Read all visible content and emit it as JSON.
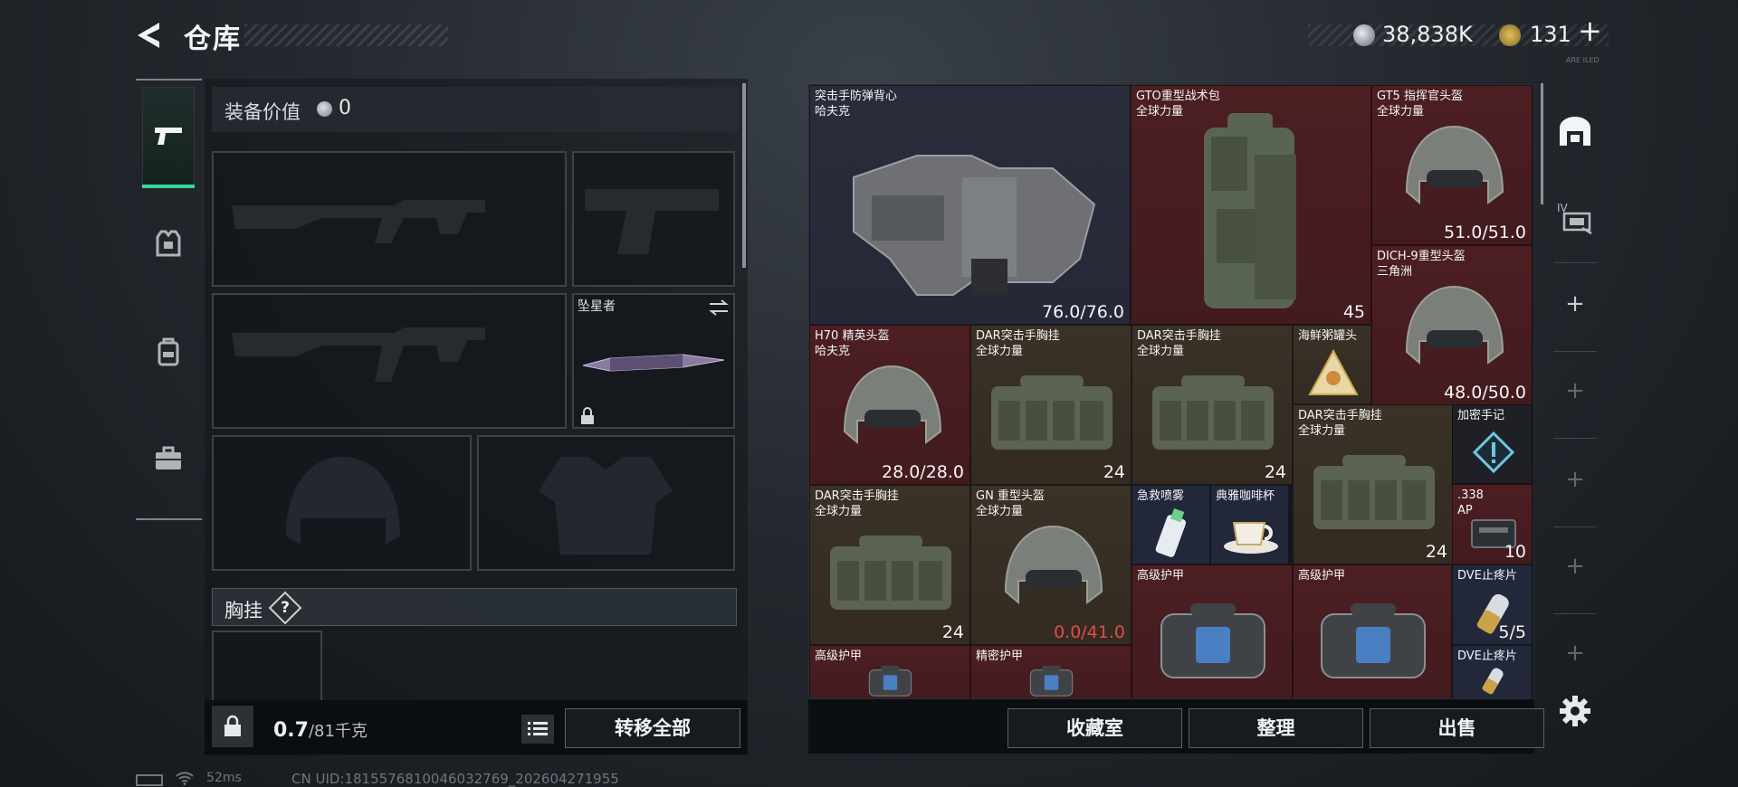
{
  "header": {
    "title": "仓库",
    "currency_main": "38,838K",
    "currency_tri": "131",
    "add_label": "+",
    "micro_text": "ARE ILED"
  },
  "nav": [
    "weapon-icon",
    "armor-icon",
    "backpack-icon",
    "case-icon"
  ],
  "loadout": {
    "equip_value_label": "装备价值",
    "equip_value": "0",
    "melee_name": "坠星者",
    "chest_label": "胸挂",
    "help_label": "?",
    "weight_current": "0.7",
    "weight_max": "/81千克",
    "transfer_all": "转移全部"
  },
  "stash_items": [
    {
      "name": "突击手防弹背心\n哈夫克",
      "value": "76.0/76.0",
      "color": "blue",
      "art": "vest"
    },
    {
      "name": "GTO重型战术包\n全球力量",
      "value": "45",
      "color": "red",
      "art": "backpack"
    },
    {
      "name": "GT5 指挥官头盔\n全球力量",
      "value": "51.0/51.0",
      "color": "red",
      "art": "helmet"
    },
    {
      "name": "DICH-9重型头盔\n三角洲",
      "value": "48.0/50.0",
      "color": "red",
      "art": "helmet"
    },
    {
      "name": "H70 精英头盔\n哈夫克",
      "value": "28.0/28.0",
      "color": "red",
      "art": "helmet"
    },
    {
      "name": "DAR突击手胸挂\n全球力量",
      "value": "24",
      "color": "brown",
      "art": "rig"
    },
    {
      "name": "DAR突击手胸挂\n全球力量",
      "value": "24",
      "color": "brown",
      "art": "rig"
    },
    {
      "name": "海鲜粥罐头",
      "value": "",
      "color": "brown",
      "art": "can"
    },
    {
      "name": "DAR突击手胸挂\n全球力量",
      "value": "24",
      "color": "brown",
      "art": "rig"
    },
    {
      "name": "加密手记",
      "value": "",
      "color": "dark",
      "art": "note"
    },
    {
      "name": "DAR突击手胸挂\n全球力量",
      "value": "24",
      "color": "brown",
      "art": "rig"
    },
    {
      "name": "GN 重型头盔\n全球力量",
      "value": "0.0/41.0",
      "color": "brown",
      "art": "helmet"
    },
    {
      "name": "急救喷雾",
      "value": "",
      "color": "navy",
      "art": "spray"
    },
    {
      "name": "典雅咖啡杯",
      "value": "",
      "color": "navy",
      "art": "cup"
    },
    {
      "name": ".338\nAP",
      "value": "10",
      "color": "red",
      "art": "ammo"
    },
    {
      "name": "高级护甲",
      "value": "",
      "color": "red",
      "art": "armorbag"
    },
    {
      "name": "高级护甲",
      "value": "",
      "color": "red",
      "art": "armorbag"
    },
    {
      "name": "DVE止疼片",
      "value": "5/5",
      "color": "navy",
      "art": "pill"
    },
    {
      "name": "高级护甲",
      "value": "",
      "color": "red",
      "art": "armorbag"
    },
    {
      "name": "精密护甲",
      "value": "",
      "color": "red",
      "art": "armorbag"
    },
    {
      "name": "DVE止疼片",
      "value": "",
      "color": "navy",
      "art": "pill"
    }
  ],
  "stash_buttons": {
    "collection": "收藏室",
    "organize": "整理",
    "sell": "出售"
  },
  "rail": {
    "tab_iv_label": "IV",
    "plus": "+"
  },
  "status": {
    "ping": "52ms",
    "uid": "CN UID:1815576810046032769_202604271955"
  },
  "colors": {
    "accent": "#39d59a",
    "cell_red": "#4a1d21",
    "cell_blue": "#292b3b",
    "cell_brown": "#382f25",
    "damage_red": "#e24b4b"
  }
}
